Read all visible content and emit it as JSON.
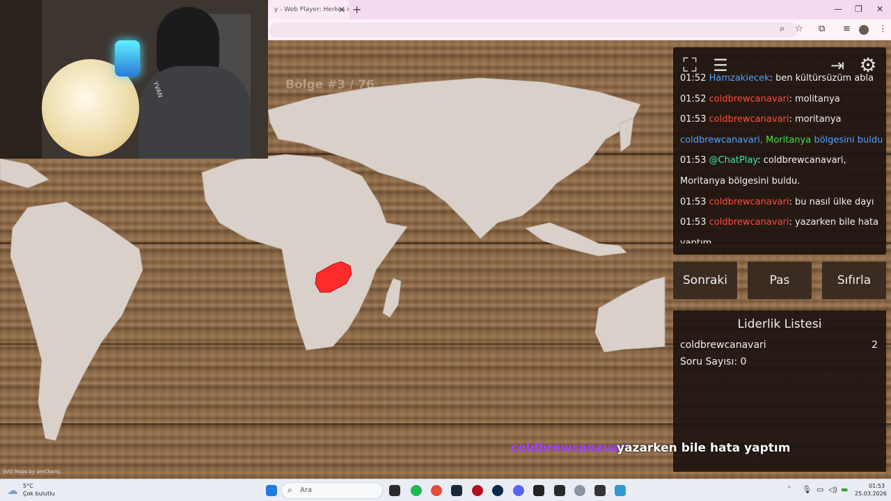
{
  "browser": {
    "tab_title": "y - Web Player: Herkes iç",
    "tab_close": "✕",
    "new_tab": "+",
    "window_controls": [
      "—",
      "❐",
      "✕"
    ]
  },
  "game": {
    "region_counter": "Bölge #3 / 76",
    "map_credit": "SVG Maps by amCharts",
    "chat": [
      [
        {
          "t": "01:52 ",
          "c": "#f2f2f2"
        },
        {
          "t": "Hamzakiecek",
          "c": "#4da3ff"
        },
        {
          "t": ": ben kültürsüzüm abla",
          "c": "#f2f2f2"
        }
      ],
      [
        {
          "t": "01:52 ",
          "c": "#f2f2f2"
        },
        {
          "t": "coldbrewcanavari",
          "c": "#ff4a3d"
        },
        {
          "t": ": molitanya",
          "c": "#f2f2f2"
        }
      ],
      [
        {
          "t": "01:53 ",
          "c": "#f2f2f2"
        },
        {
          "t": "coldbrewcanavari",
          "c": "#ff4a3d"
        },
        {
          "t": ": moritanya",
          "c": "#f2f2f2"
        }
      ],
      [
        {
          "t": "coldbrewcanavari, ",
          "c": "#4da3ff"
        },
        {
          "t": "Moritanya",
          "c": "#46e04a"
        },
        {
          "t": " bölgesini buldu.",
          "c": "#4da3ff"
        }
      ],
      [
        {
          "t": "01:53 ",
          "c": "#f2f2f2"
        },
        {
          "t": "@ChatPlay",
          "c": "#3fe6a6"
        },
        {
          "t": ": coldbrewcanavari,",
          "c": "#f2f2f2"
        }
      ],
      [
        {
          "t": "Moritanya bölgesini buldu.",
          "c": "#f2f2f2"
        }
      ],
      [
        {
          "t": "01:53 ",
          "c": "#f2f2f2"
        },
        {
          "t": "coldbrewcanavari",
          "c": "#ff4a3d"
        },
        {
          "t": ": bu nasıl ülke dayı",
          "c": "#f2f2f2"
        }
      ],
      [
        {
          "t": "01:53 ",
          "c": "#f2f2f2"
        },
        {
          "t": "coldbrewcanavari",
          "c": "#ff4a3d"
        },
        {
          "t": ": yazarken bile hata",
          "c": "#f2f2f2"
        }
      ],
      [
        {
          "t": "yaptım",
          "c": "#f2f2f2"
        }
      ]
    ],
    "buttons": {
      "next": "Sonraki",
      "pass": "Pas",
      "reset": "Sıfırla"
    },
    "leaderboard": {
      "title": "Liderlik Listesi",
      "entries": [
        {
          "name": "coldbrewcanavari",
          "score": "2"
        }
      ],
      "question_count": "Soru Sayısı: 0"
    },
    "overlay_message": {
      "user": "coldbrewcanavari",
      "text": "yazarken bile hata yaptım",
      "user_color": "#a040ff"
    },
    "highlight_color": "#ff2a2a",
    "land_color": "#d9d0c9",
    "webcam": {
      "caption": "YVAN"
    }
  },
  "taskbar": {
    "weather_temp": "5°C",
    "weather_desc": "Çok bulutlu",
    "search_label": "Ara",
    "time": "01:53",
    "date": "25.03.2026"
  }
}
